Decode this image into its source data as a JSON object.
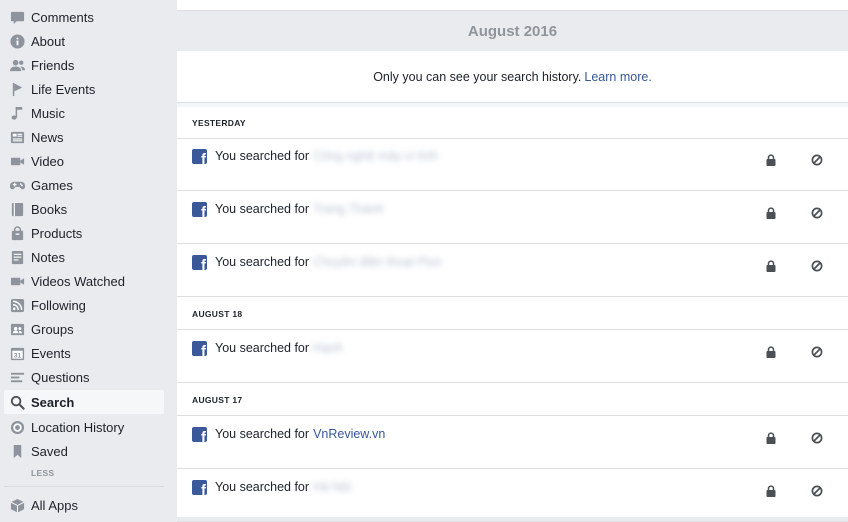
{
  "sidebar": {
    "items": [
      {
        "label": "Comments",
        "icon": "comment-icon"
      },
      {
        "label": "About",
        "icon": "info-icon"
      },
      {
        "label": "Friends",
        "icon": "friends-icon"
      },
      {
        "label": "Life Events",
        "icon": "flag-icon"
      },
      {
        "label": "Music",
        "icon": "music-note-icon"
      },
      {
        "label": "News",
        "icon": "news-icon"
      },
      {
        "label": "Video",
        "icon": "video-camera-icon"
      },
      {
        "label": "Games",
        "icon": "gamepad-icon"
      },
      {
        "label": "Books",
        "icon": "book-icon"
      },
      {
        "label": "Products",
        "icon": "shopping-bag-icon"
      },
      {
        "label": "Notes",
        "icon": "note-icon"
      },
      {
        "label": "Videos Watched",
        "icon": "video-camera-icon"
      },
      {
        "label": "Following",
        "icon": "rss-icon"
      },
      {
        "label": "Groups",
        "icon": "groups-icon"
      },
      {
        "label": "Events",
        "icon": "calendar-icon"
      },
      {
        "label": "Questions",
        "icon": "questions-icon"
      },
      {
        "label": "Search",
        "icon": "search-icon",
        "active": true
      },
      {
        "label": "Location History",
        "icon": "location-target-icon"
      },
      {
        "label": "Saved",
        "icon": "bookmark-icon"
      }
    ],
    "less_label": "LESS",
    "all_apps_label": "All Apps",
    "calendar_day": "31"
  },
  "main": {
    "month": "August 2016",
    "notice_text": "Only you can see your search history.",
    "learn_more": "Learn more.",
    "sections": [
      {
        "header": "YESTERDAY",
        "rows": [
          {
            "prefix": "You searched for",
            "query": "Công nghệ máy vi tính",
            "blurred": true
          },
          {
            "prefix": "You searched for",
            "query": "Trang Thành",
            "blurred": true
          },
          {
            "prefix": "You searched for",
            "query": "Chuyên điện thoại Plus",
            "blurred": true
          }
        ]
      },
      {
        "header": "AUGUST 18",
        "rows": [
          {
            "prefix": "You searched for",
            "query": "Hạnh",
            "blurred": true
          }
        ]
      },
      {
        "header": "AUGUST 17",
        "rows": [
          {
            "prefix": "You searched for",
            "query": "VnReview.vn",
            "blurred": false
          },
          {
            "prefix": "You searched for",
            "query": "Hà Nội",
            "blurred": true
          }
        ]
      }
    ]
  },
  "colors": {
    "facebook_blue": "#3b5998",
    "link_blue": "#365899",
    "sidebar_bg": "#e9ebee",
    "icon_gray": "#8d949e"
  }
}
